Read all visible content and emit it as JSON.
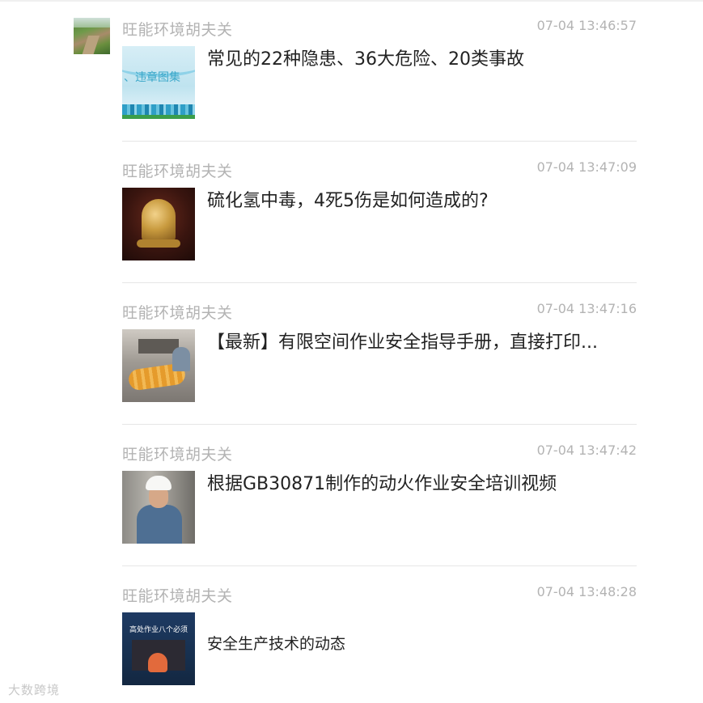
{
  "items": [
    {
      "sender": "旺能环境胡夫关",
      "time": "07-04 13:46:57",
      "title": "常见的22种隐患、36大危险、20类事故",
      "thumb_label": "、违章图集"
    },
    {
      "sender": "旺能环境胡夫关",
      "time": "07-04 13:47:09",
      "title": "硫化氢中毒，4死5伤是如何造成的?"
    },
    {
      "sender": "旺能环境胡夫关",
      "time": "07-04 13:47:16",
      "title": "【最新】有限空间作业安全指导手册，直接打印..."
    },
    {
      "sender": "旺能环境胡夫关",
      "time": "07-04 13:47:42",
      "title": "根据GB30871制作的动火作业安全培训视频"
    },
    {
      "sender": "旺能环境胡夫关",
      "time": "07-04 13:48:28",
      "title": "安全生产技术的动态",
      "thumb_heading": "高处作业八个必须"
    }
  ],
  "watermark": "大数跨境",
  "icons": {
    "avatar": "scenic-path-avatar"
  }
}
